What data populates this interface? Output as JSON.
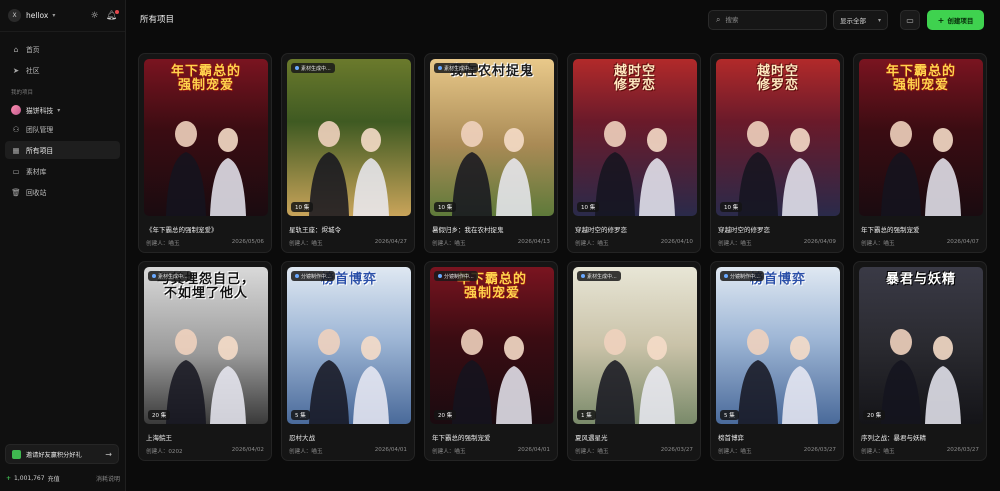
{
  "sidebar": {
    "user": {
      "initial": "X",
      "name": "hellox"
    },
    "nav": [
      {
        "label": "首页",
        "icon": "home-icon"
      },
      {
        "label": "社区",
        "icon": "send-icon"
      }
    ],
    "section_label": "我的项目",
    "team_name": "猫饼科技",
    "team_nav": [
      {
        "label": "团队管理",
        "icon": "users-icon"
      },
      {
        "label": "所有项目",
        "icon": "grid-icon",
        "active": true
      },
      {
        "label": "素材库",
        "icon": "folder-icon"
      },
      {
        "label": "回收站",
        "icon": "trash-icon"
      }
    ],
    "invite_label": "邀请好友赢积分好礼",
    "credits": "1,001,767",
    "credits_action": "充值",
    "credits_rule": "消耗说明"
  },
  "header": {
    "title": "所有项目",
    "search_placeholder": "搜索",
    "filter_label": "显示全部",
    "create_label": "创建项目"
  },
  "projects": [
    {
      "title": "《年下霸总的强制宠爱》",
      "creator": "创建人：喵玉",
      "date": "2026/05/06",
      "cover_text": "年下霸总的\n强制宠爱",
      "theme": "romance",
      "status": "",
      "episodes": ""
    },
    {
      "title": "星轨王座：烬城令",
      "creator": "创建人：喵玉",
      "date": "2026/04/27",
      "cover_text": "",
      "theme": "bride",
      "status": "素材生成中...",
      "episodes": "10 集"
    },
    {
      "title": "暑假归乡：我在农村捉鬼",
      "creator": "创建人：喵玉",
      "date": "2026/04/13",
      "cover_text": "我在农村捉鬼",
      "theme": "village",
      "status": "素材生成中...",
      "episodes": "10 集"
    },
    {
      "title": "穿越时空的修罗恋",
      "creator": "创建人：喵玉",
      "date": "2026/04/10",
      "cover_text": "越时空\n修罗恋",
      "theme": "ancient",
      "status": "",
      "episodes": "10 集"
    },
    {
      "title": "穿越时空的修罗恋",
      "creator": "创建人：喵玉",
      "date": "2026/04/09",
      "cover_text": "越时空\n修罗恋",
      "theme": "ancient",
      "status": "",
      "episodes": "10 集"
    },
    {
      "title": "年下霸总的强制宠爱",
      "creator": "创建人：喵玉",
      "date": "2026/04/07",
      "cover_text": "年下霸总的\n强制宠爱",
      "theme": "romance",
      "status": "",
      "episodes": ""
    },
    {
      "title": "上海鲩王",
      "creator": "创建人：0202",
      "date": "2026/04/02",
      "cover_text": "与其埋怨自己，\n不如埋了他人",
      "theme": "cat",
      "status": "素材生成中...",
      "episodes": "20 集"
    },
    {
      "title": "忍村大战",
      "creator": "创建人：喵玉",
      "date": "2026/04/01",
      "cover_text": "榜首博弈",
      "theme": "school",
      "status": "分镜制作中...",
      "episodes": "5 集"
    },
    {
      "title": "年下霸总的强制宠爱",
      "creator": "创建人：喵玉",
      "date": "2026/04/01",
      "cover_text": "年下霸总的\n强制宠爱",
      "theme": "romance",
      "status": "分镜制作中...",
      "episodes": "20 集"
    },
    {
      "title": "夏风遇星光",
      "creator": "创建人：喵玉",
      "date": "2026/03/27",
      "cover_text": "",
      "theme": "campus",
      "status": "素材生成中...",
      "episodes": "1 集"
    },
    {
      "title": "榜首博弈",
      "creator": "创建人：喵玉",
      "date": "2026/03/27",
      "cover_text": "榜首博弈",
      "theme": "school",
      "status": "分镜制作中...",
      "episodes": "5 集"
    },
    {
      "title": "序列之战：暴君与妖精",
      "creator": "创建人：喵玉",
      "date": "2026/03/27",
      "cover_text": "暴君与妖精",
      "theme": "dark",
      "status": "",
      "episodes": "20 集"
    }
  ],
  "colors": {
    "accent": "#3fd24f",
    "bg": "#0b0b0b",
    "card": "#151515"
  }
}
